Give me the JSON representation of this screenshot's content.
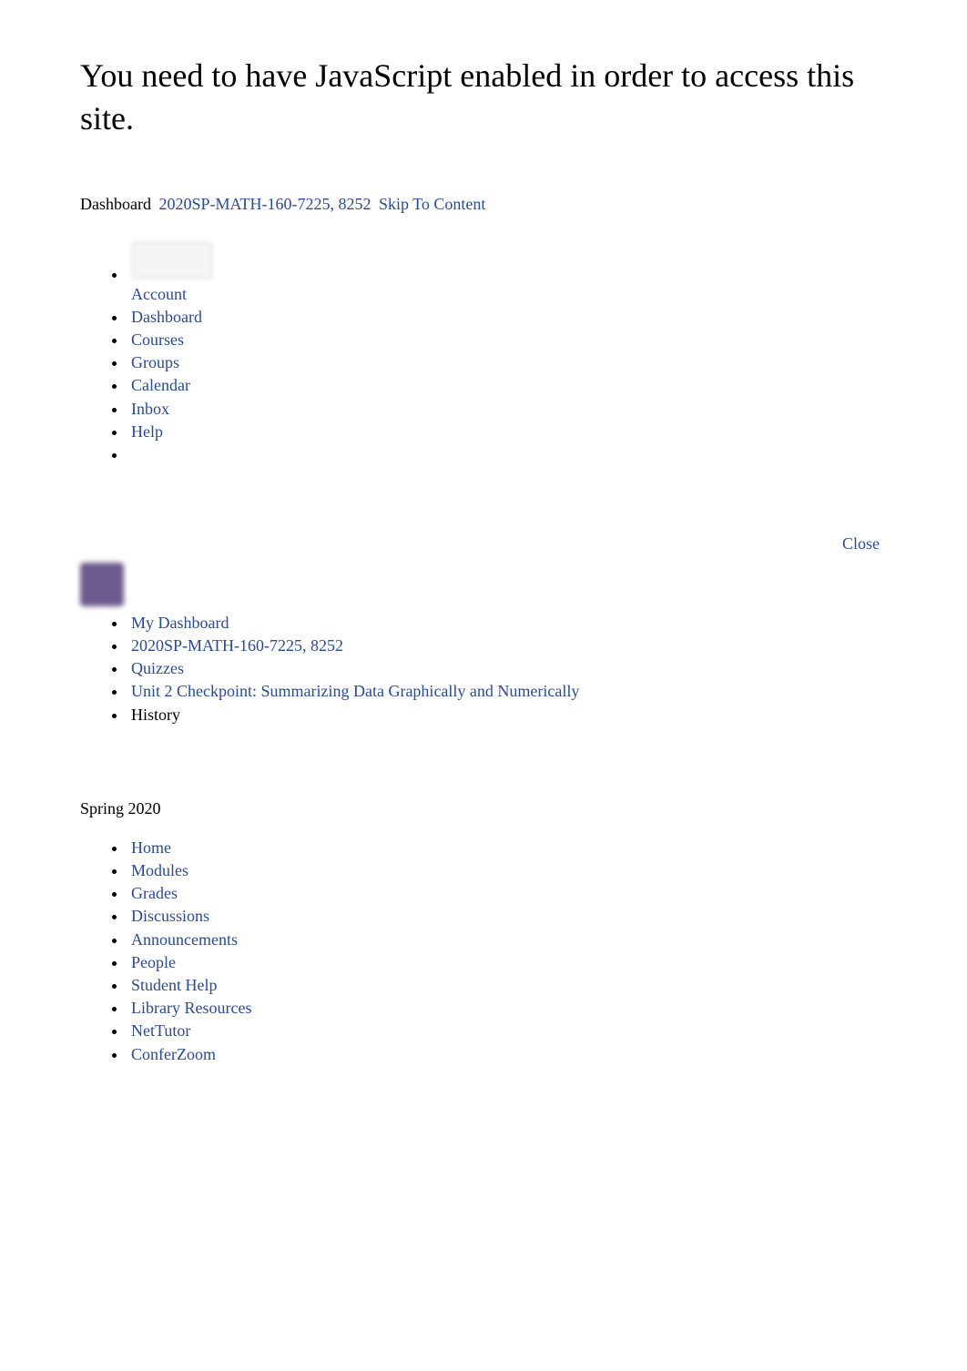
{
  "heading": "You need to have JavaScript enabled in order to access this site.",
  "breadcrumb": {
    "dashboard": "Dashboard",
    "course": "2020SP-MATH-160-7225, 8252",
    "skip": "Skip To Content"
  },
  "globalNav": {
    "account": "Account",
    "dashboard": "Dashboard",
    "courses": "Courses",
    "groups": "Groups",
    "calendar": "Calendar",
    "inbox": "Inbox",
    "help": "Help"
  },
  "close": "Close",
  "crumbs": {
    "myDashboard": "My Dashboard",
    "course": "2020SP-MATH-160-7225, 8252",
    "quizzes": "Quizzes",
    "quizTitle": "Unit 2 Checkpoint: Summarizing Data Graphically and Numerically",
    "history": "History"
  },
  "term": "Spring 2020",
  "courseNav": {
    "home": "Home",
    "modules": "Modules",
    "grades": "Grades",
    "discussions": "Discussions",
    "announcements": "Announcements",
    "people": "People",
    "studentHelp": "Student Help",
    "libraryResources": "Library Resources",
    "netTutor": "NetTutor",
    "conferZoom": "ConferZoom"
  }
}
